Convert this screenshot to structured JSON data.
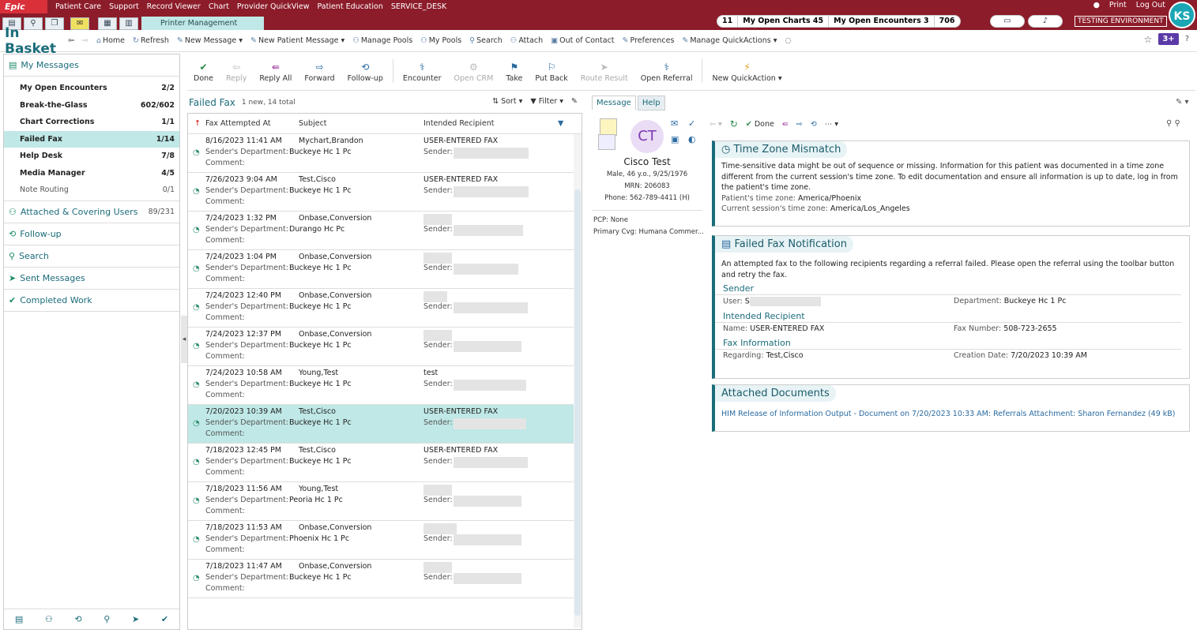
{
  "topbar": {
    "epic": "Epic",
    "menus": [
      "Patient Care",
      "Support",
      "Record Viewer",
      "Chart",
      "Provider QuickView",
      "Patient Education",
      "SERVICE_DESK"
    ],
    "right": [
      "Print",
      "Log Out"
    ],
    "active_tab": "Printer Management",
    "counters": [
      "11",
      "My Open Charts 45",
      "My Open Encounters 3",
      "706"
    ],
    "env": "TESTING ENVIRONMENT",
    "avatar": "KS"
  },
  "bar2": {
    "title": "In Basket",
    "items": [
      "Home",
      "Refresh",
      "New Message",
      "New Patient Message",
      "Manage Pools",
      "My Pools",
      "Search",
      "Attach",
      "Out of Contact",
      "Preferences",
      "Manage QuickActions"
    ],
    "badge": "3+"
  },
  "left": {
    "head": "My Messages",
    "items": [
      {
        "label": "My Open Encounters",
        "n": "2/2"
      },
      {
        "label": "Break-the-Glass",
        "n": "602/602"
      },
      {
        "label": "Chart Corrections",
        "n": "1/1"
      },
      {
        "label": "Failed Fax",
        "n": "1/14"
      },
      {
        "label": "Help Desk",
        "n": "7/8"
      },
      {
        "label": "Media Manager",
        "n": "4/5"
      },
      {
        "label": "Note Routing",
        "n": "0/1"
      }
    ],
    "sections": [
      {
        "label": "Attached & Covering Users",
        "n": "89/231"
      },
      {
        "label": "Follow-up",
        "n": ""
      },
      {
        "label": "Search",
        "n": ""
      },
      {
        "label": "Sent Messages",
        "n": ""
      },
      {
        "label": "Completed Work",
        "n": ""
      }
    ]
  },
  "actions": [
    "Done",
    "Reply",
    "Reply All",
    "Forward",
    "Follow-up",
    "Encounter",
    "Open CRM",
    "Take",
    "Put Back",
    "Route Result",
    "Open Referral",
    "New QuickAction"
  ],
  "list": {
    "title": "Failed Fax",
    "sub": "1 new, 14 total",
    "tools": [
      "Sort",
      "Filter"
    ],
    "cols": [
      "Fax Attempted At",
      "Subject",
      "Intended Recipient"
    ],
    "dept_label": "Sender's Department:",
    "comment": "Comment:",
    "sender": "Sender:",
    "rows": [
      {
        "time": "8/16/2023 11:41 AM",
        "subject": "Mychart,Brandon",
        "dept": "Buckeye Hc 1 Pc",
        "recip": "USER-ENTERED FAX"
      },
      {
        "time": "7/26/2023 9:04 AM",
        "subject": "Test,Cisco",
        "dept": "Buckeye Hc 1 Pc",
        "recip": "USER-ENTERED FAX"
      },
      {
        "time": "7/24/2023 1:32 PM",
        "subject": "Onbase,Conversion",
        "dept": "Durango Hc Pc",
        "recip": ""
      },
      {
        "time": "7/24/2023 1:04 PM",
        "subject": "Onbase,Conversion",
        "dept": "Buckeye Hc 1 Pc",
        "recip": ""
      },
      {
        "time": "7/24/2023 12:40 PM",
        "subject": "Onbase,Conversion",
        "dept": "Buckeye Hc 1 Pc",
        "recip": ""
      },
      {
        "time": "7/24/2023 12:37 PM",
        "subject": "Onbase,Conversion",
        "dept": "Buckeye Hc 1 Pc",
        "recip": ""
      },
      {
        "time": "7/24/2023 10:58 AM",
        "subject": "Young,Test",
        "dept": "Buckeye Hc 1 Pc",
        "recip": "test"
      },
      {
        "time": "7/20/2023 10:39 AM",
        "subject": "Test,Cisco",
        "dept": "Buckeye Hc 1 Pc",
        "recip": "USER-ENTERED FAX"
      },
      {
        "time": "7/18/2023 12:45 PM",
        "subject": "Test,Cisco",
        "dept": "Buckeye Hc 1 Pc",
        "recip": "USER-ENTERED FAX"
      },
      {
        "time": "7/18/2023 11:56 AM",
        "subject": "Young,Test",
        "dept": "Peoria Hc 1 Pc",
        "recip": ""
      },
      {
        "time": "7/18/2023 11:53 AM",
        "subject": "Onbase,Conversion",
        "dept": "Phoenix Hc 1 Pc",
        "recip": ""
      },
      {
        "time": "7/18/2023 11:47 AM",
        "subject": "Onbase,Conversion",
        "dept": "Buckeye Hc 1 Pc",
        "recip": ""
      }
    ]
  },
  "detail": {
    "tabs": [
      "Message",
      "Help"
    ],
    "initials": "CT",
    "name": "Cisco Test",
    "line1": "Male, 46 y.o., 9/25/1976",
    "line2": "MRN: 206083",
    "line3": "Phone: 562-789-4411 (H)",
    "pcp": "PCP: None",
    "cvg": "Primary Cvg: Humana Commer...",
    "done": "Done",
    "tz": {
      "title": "Time Zone Mismatch",
      "text": "Time-sensitive data might be out of sequence or missing. Information for this patient was documented in a time zone different from the current session's time zone. To edit documentation and ensure all information is up to date, log in from the patient's time zone.",
      "pat_label": "Patient's time zone:",
      "pat": "America/Phoenix",
      "cur_label": "Current session's time zone:",
      "cur": "America/Los_Angeles"
    },
    "fax": {
      "title": "Failed Fax Notification",
      "text": "An attempted fax to the following recipients regarding a referral failed. Please open the referral using the toolbar button and retry the fax.",
      "sender": "Sender",
      "user_label": "User:",
      "user": "S",
      "dept_label": "Department:",
      "dept": "Buckeye Hc 1 Pc",
      "recip": "Intended Recipient",
      "name_label": "Name:",
      "name": "USER-ENTERED FAX",
      "faxno_label": "Fax Number:",
      "faxno": "508-723-2655",
      "info": "Fax Information",
      "reg_label": "Regarding:",
      "reg": "Test,Cisco",
      "cd_label": "Creation Date:",
      "cd": "7/20/2023 10:39 AM"
    },
    "att": {
      "title": "Attached Documents",
      "link": "HIM Release of Information Output - Document on 7/20/2023 10:33 AM: Referrals Attachment: Sharon Fernandez (49 kB)"
    }
  }
}
